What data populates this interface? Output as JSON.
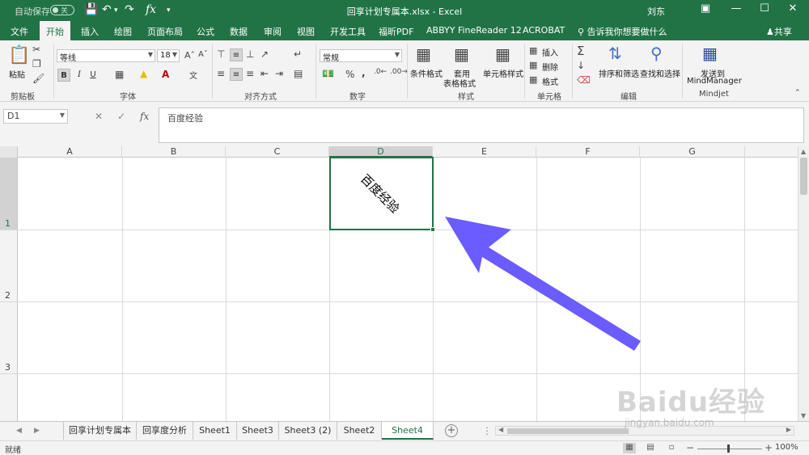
{
  "titlebar": {
    "autosave_label": "自动保存",
    "autosave_state": "关",
    "document_title": "回享计划专属本.xlsx  -  Excel",
    "user": "刘东"
  },
  "tabs": [
    {
      "label": "文件",
      "active": false
    },
    {
      "label": "开始",
      "active": true
    },
    {
      "label": "插入",
      "active": false
    },
    {
      "label": "绘图",
      "active": false
    },
    {
      "label": "页面布局",
      "active": false
    },
    {
      "label": "公式",
      "active": false
    },
    {
      "label": "数据",
      "active": false
    },
    {
      "label": "审阅",
      "active": false
    },
    {
      "label": "视图",
      "active": false
    },
    {
      "label": "开发工具",
      "active": false
    },
    {
      "label": "福昕PDF",
      "active": false
    },
    {
      "label": "ABBYY FineReader 12",
      "active": false
    },
    {
      "label": "ACROBAT",
      "active": false
    }
  ],
  "tell_me": "告诉我你想要做什么",
  "share": "共享",
  "ribbon": {
    "clipboard": {
      "paste": "粘贴",
      "group": "剪贴板"
    },
    "font": {
      "name": "等线",
      "size": "18",
      "group": "字体",
      "bold": "B",
      "italic": "I",
      "underline": "U"
    },
    "alignment": {
      "group": "对齐方式"
    },
    "number": {
      "format": "常规",
      "group": "数字",
      "percent": "%",
      "comma": ","
    },
    "styles": {
      "conditional": "条件格式",
      "table_format_1": "套用",
      "table_format_2": "表格格式",
      "cell_styles": "单元格样式",
      "group": "样式"
    },
    "cells": {
      "insert": "插入",
      "delete": "删除",
      "format": "格式",
      "group": "单元格"
    },
    "editing": {
      "sum": "Σ",
      "sort_filter": "排序和筛选",
      "find_select": "查找和选择",
      "group": "编辑"
    },
    "mindjet": {
      "send_to_1": "发送到",
      "send_to_2": "MindManager",
      "group": "Mindjet"
    }
  },
  "formula_bar": {
    "name_box": "D1",
    "fx": "fx",
    "content": "百度经验"
  },
  "columns": [
    "A",
    "B",
    "C",
    "D",
    "E",
    "F",
    "G"
  ],
  "rows": [
    "1",
    "2",
    "3"
  ],
  "selected_cell": {
    "column": "D",
    "row": "1",
    "text": "百度经验"
  },
  "sheets": [
    {
      "name": "回享计划专属本",
      "active": false
    },
    {
      "name": "回享度分析",
      "active": false
    },
    {
      "name": "Sheet1",
      "active": false
    },
    {
      "name": "Sheet3",
      "active": false
    },
    {
      "name": "Sheet3 (2)",
      "active": false
    },
    {
      "name": "Sheet2",
      "active": false
    },
    {
      "name": "Sheet4",
      "active": true
    }
  ],
  "status": {
    "ready": "就绪",
    "zoom": "100%"
  },
  "watermark": {
    "logo": "Baidu经验",
    "url": "jingyan.baidu.com"
  },
  "colors": {
    "excel_green": "#217346",
    "arrow": "#6b5cff"
  }
}
